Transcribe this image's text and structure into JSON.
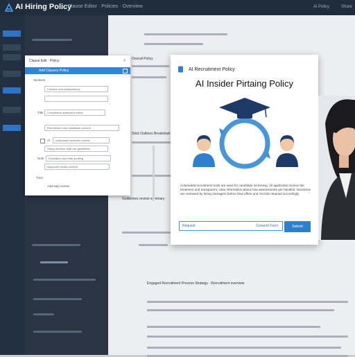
{
  "topbar": {
    "title": "AI Hiring Policy",
    "crumbs": "Clause Editor · Policies · Overview",
    "link_1": "Ai Policy",
    "link_2": "Share"
  },
  "form_dialog": {
    "title": "Clause Edit · Policy",
    "bar_label": "Add Clauses Policy",
    "section_label": "Sections",
    "fields": [
      {
        "label": "",
        "value": "Fairness and transparency"
      },
      {
        "label": "",
        "value": ""
      },
      {
        "label": "Title",
        "value": "Compliance statement notice"
      },
      {
        "label": "",
        "value": "Recruitment and candidate consent"
      },
      {
        "label": "Al",
        "value": "Automated selection criteria"
      },
      {
        "label": "",
        "value": "Hiring decision data use guidelines"
      },
      {
        "label": "Note",
        "value": "Evaluation and bias auditing"
      },
      {
        "label": "",
        "value": "Approved review content"
      },
      {
        "label": "Time",
        "value": ""
      },
      {
        "label": "",
        "value": "Add step review"
      }
    ]
  },
  "policy_modal": {
    "header": "AI Recruitment Policy",
    "title": "AI Insider Pirtaing Policy",
    "body": "Automated recruitment tools are used for candidate screening. All applicants receive fair treatment and transparent, clear information about how assessments are handled. Decisions are reviewed by hiring managers before final offers and records retained accordingly.",
    "input_placeholder": "Request",
    "input_right": "Consent Form",
    "button_label": "Submit",
    "accent": "#2f7fd0"
  },
  "main": {
    "headings": [
      "Overall Policy",
      "Stick Outlines Breakdown",
      "Guidelines review summary",
      "Engaged Recruitment Process Strategy · Recruitment overview"
    ]
  }
}
